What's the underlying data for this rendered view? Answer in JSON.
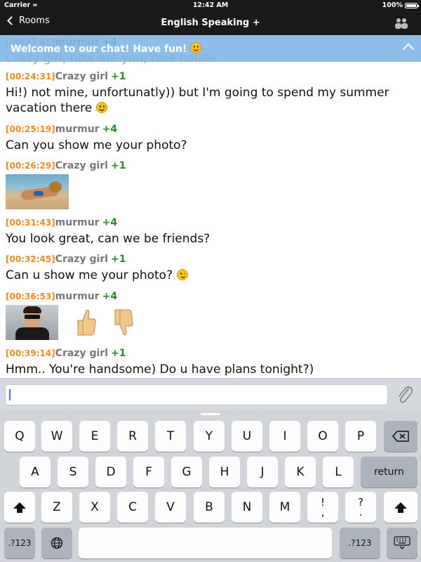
{
  "status_bar": {
    "carrier": "Carrier",
    "time": "12:42 AM",
    "battery": "100%"
  },
  "nav": {
    "back_label": "Rooms",
    "title": "English Speaking +"
  },
  "banner": {
    "text": "Welcome to our chat! Have fun!"
  },
  "messages": [
    {
      "time": "[00:24:31]",
      "nick": "Crazy girl",
      "karma": "+1",
      "text": "Hi!) not mine, unfortunatly)) but I'm going to spend my summer vacation there",
      "emoji": "grinning-emoji"
    },
    {
      "time": "[00:25:19]",
      "nick": "murmur",
      "karma": "+4",
      "text": "Can you show me your photo?"
    },
    {
      "time": "[00:26:29]",
      "nick": "Crazy girl",
      "karma": "+1",
      "attachment": "beach-photo"
    },
    {
      "time": "[00:31:43]",
      "nick": "murmur",
      "karma": "+4",
      "text": "You look great, can we be friends?"
    },
    {
      "time": "[00:32:45]",
      "nick": "Crazy girl",
      "karma": "+1",
      "text": "Can u show me your photo?",
      "emoji": "winking-emoji"
    },
    {
      "time": "[00:36:53]",
      "nick": "murmur",
      "karma": "+4",
      "attachment": "man-photo",
      "extra_icons": [
        "thumbs-up-icon",
        "thumbs-down-icon"
      ]
    },
    {
      "time": "[00:39:14]",
      "nick": "Crazy girl",
      "karma": "+1",
      "text": "Hmm.. You're handsome) Do u have plans tonight?)"
    }
  ],
  "composer": {
    "value": "",
    "attach_icon": "paperclip-icon"
  },
  "keyboard": {
    "row1": [
      "Q",
      "W",
      "E",
      "R",
      "T",
      "Y",
      "U",
      "I",
      "O",
      "P"
    ],
    "row2": [
      "A",
      "S",
      "D",
      "F",
      "G",
      "H",
      "J",
      "K",
      "L"
    ],
    "row3": [
      "Z",
      "X",
      "C",
      "V",
      "B",
      "N",
      "M"
    ],
    "punct1": [
      "!",
      ","
    ],
    "punct2": [
      "?",
      "."
    ],
    "return_label": "return",
    "numbers_label": ".?123",
    "icons": [
      "backspace-icon",
      "shift-icon",
      "globe-icon",
      "keyboard-dismiss-icon"
    ]
  },
  "colors": {
    "banner": "#7db4e6",
    "timestamp": "#f08a1a",
    "karma": "#2a8a2a",
    "nick": "#777777"
  }
}
